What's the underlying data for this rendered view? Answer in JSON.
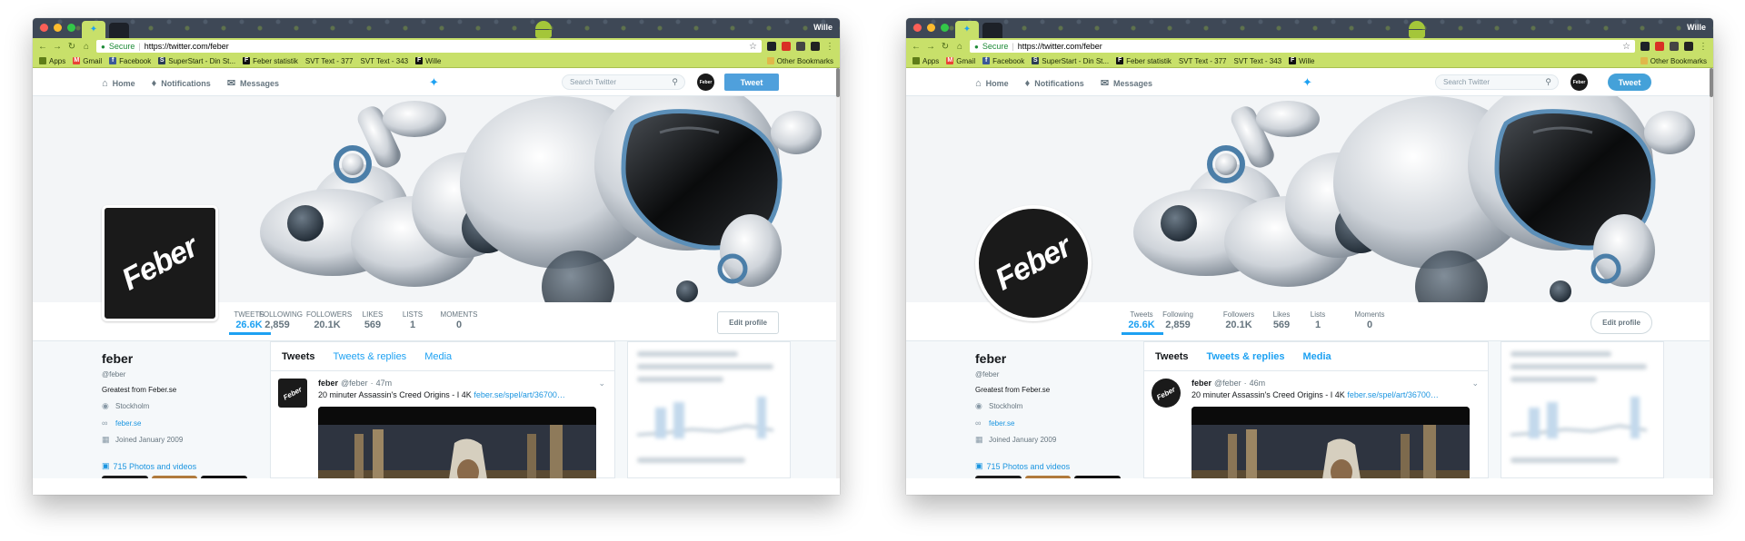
{
  "windows": [
    {
      "variant": "old",
      "browser": {
        "profile_name": "Wille",
        "secure_label": "Secure",
        "url": "https://twitter.com/feber",
        "bookmarks": [
          "Apps",
          "Gmail",
          "Facebook",
          "SuperStart - Din St...",
          "Feber statistik",
          "SVT Text - 377",
          "SVT Text - 343",
          "Wille"
        ],
        "other_bookmarks": "Other Bookmarks"
      },
      "nav": {
        "home": "Home",
        "notifications": "Notifications",
        "messages": "Messages",
        "search_placeholder": "Search Twitter",
        "tweet_button": "Tweet"
      },
      "avatar_text": "Feber",
      "stats": [
        {
          "label": "TWEETS",
          "value": "26.6K"
        },
        {
          "label": "FOLLOWING",
          "value": "2,859"
        },
        {
          "label": "FOLLOWERS",
          "value": "20.1K"
        },
        {
          "label": "LIKES",
          "value": "569"
        },
        {
          "label": "LISTS",
          "value": "1"
        },
        {
          "label": "MOMENTS",
          "value": "0"
        }
      ],
      "edit_profile": "Edit profile",
      "profile": {
        "name": "feber",
        "handle": "@feber",
        "bio": "Greatest from Feber.se",
        "location": "Stockholm",
        "website": "feber.se",
        "joined": "Joined January 2009",
        "photos": "715 Photos and videos"
      },
      "tabs": [
        "Tweets",
        "Tweets & replies",
        "Media"
      ],
      "tweet": {
        "author": "feber",
        "handle": "@feber",
        "time": "47m",
        "text": "20 minuter Assassin's Creed Origins - I 4K",
        "link": "feber.se/spel/art/36700…"
      }
    },
    {
      "variant": "new",
      "browser": {
        "profile_name": "Wille",
        "secure_label": "Secure",
        "url": "https://twitter.com/feber",
        "bookmarks": [
          "Apps",
          "Gmail",
          "Facebook",
          "SuperStart - Din St...",
          "Feber statistik",
          "SVT Text - 377",
          "SVT Text - 343",
          "Wille"
        ],
        "other_bookmarks": "Other Bookmarks"
      },
      "nav": {
        "home": "Home",
        "notifications": "Notifications",
        "messages": "Messages",
        "search_placeholder": "Search Twitter",
        "tweet_button": "Tweet"
      },
      "avatar_text": "Feber",
      "stats": [
        {
          "label": "Tweets",
          "value": "26.6K"
        },
        {
          "label": "Following",
          "value": "2,859"
        },
        {
          "label": "Followers",
          "value": "20.1K"
        },
        {
          "label": "Likes",
          "value": "569"
        },
        {
          "label": "Lists",
          "value": "1"
        },
        {
          "label": "Moments",
          "value": "0"
        }
      ],
      "edit_profile": "Edit profile",
      "profile": {
        "name": "feber",
        "handle": "@feber",
        "bio": "Greatest from Feber.se",
        "location": "Stockholm",
        "website": "feber.se",
        "joined": "Joined January 2009",
        "photos": "715 Photos and videos"
      },
      "tabs": [
        "Tweets",
        "Tweets & replies",
        "Media"
      ],
      "tweet": {
        "author": "feber",
        "handle": "@feber",
        "time": "46m",
        "text": "20 minuter Assassin's Creed Origins - I 4K",
        "link": "feber.se/spel/art/36700…"
      }
    }
  ],
  "colors": {
    "chrome_green": "#c8e06a",
    "twitter_blue": "#1da1f2",
    "link_blue": "#1b95e0",
    "avatar_black": "#1a1a1a"
  },
  "icons": [
    "home-icon",
    "bell-icon",
    "envelope-icon",
    "twitter-bird-icon",
    "search-icon",
    "location-pin-icon",
    "link-icon",
    "calendar-icon",
    "camera-icon",
    "chevron-down-icon",
    "lock-icon",
    "star-icon"
  ]
}
